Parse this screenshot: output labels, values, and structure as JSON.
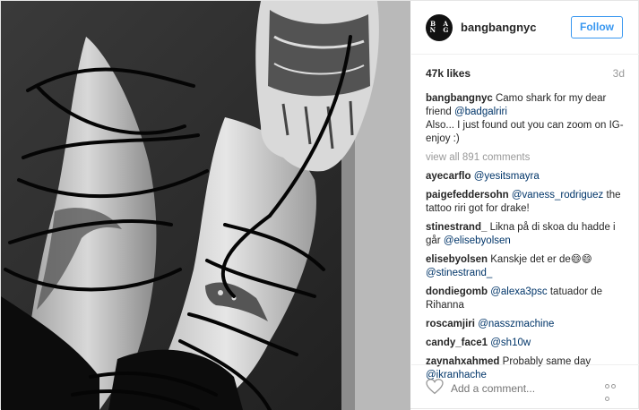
{
  "header": {
    "avatar_row1": "B A",
    "avatar_row2": "N G",
    "username": "bangbangnyc",
    "follow_label": "Follow"
  },
  "stats": {
    "likes": "47k likes",
    "time": "3d"
  },
  "caption": {
    "user": "bangbangnyc",
    "text1": "Camo shark for my dear friend ",
    "mention": "@badgalriri",
    "text2": "Also... I just found out you can zoom on IG- enjoy :)"
  },
  "view_all": "view all 891 comments",
  "comments": [
    {
      "user": "ayecarflo",
      "pre": "",
      "mention": "@yesitsmayra",
      "post": ""
    },
    {
      "user": "paigefeddersohn",
      "pre": "",
      "mention": "@vaness_rodriguez",
      "post": " the tattoo riri got for drake!"
    },
    {
      "user": "stinestrand_",
      "pre": "Likna på di skoa du hadde i går ",
      "mention": "@elisebyolsen",
      "post": ""
    },
    {
      "user": "elisebyolsen",
      "pre": "Kanskje det er de😄😄 ",
      "mention": "@stinestrand_",
      "post": ""
    },
    {
      "user": "dondiegomb",
      "pre": "",
      "mention": "@alexa3psc",
      "post": " tatuador de Rihanna"
    },
    {
      "user": "roscamjiri",
      "pre": "",
      "mention": "@nasszmachine",
      "post": ""
    },
    {
      "user": "candy_face1",
      "pre": "",
      "mention": "@sh10w",
      "post": ""
    },
    {
      "user": "zaynahxahmed",
      "pre": "Probably same day ",
      "mention": "@ikranhache",
      "post": ""
    }
  ],
  "footer": {
    "comment_placeholder": "Add a comment..."
  },
  "icons": {
    "like": "heart-icon",
    "more": "more-options-icon"
  },
  "colors": {
    "accent": "#3897f0",
    "mention": "#003569",
    "muted": "#999999"
  }
}
